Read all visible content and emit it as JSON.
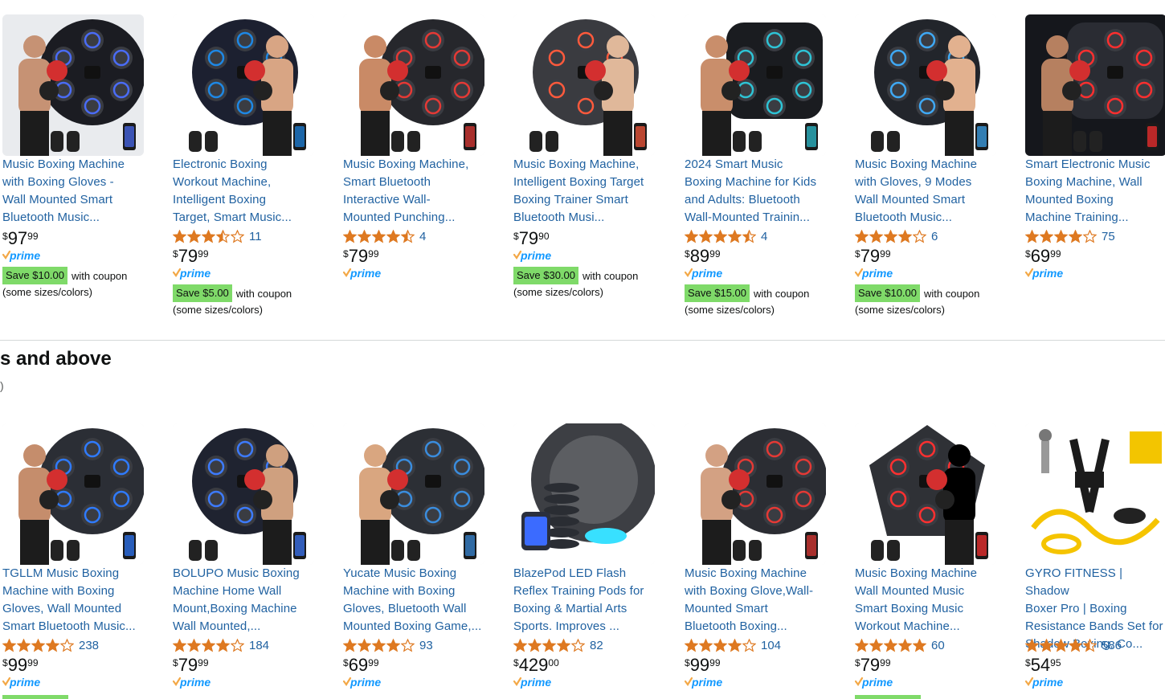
{
  "section": {
    "title": "s and above",
    "subtitle": ")"
  },
  "colors": {
    "link": "#2162a1",
    "star": "#de7921",
    "coupon": "#7fda69",
    "prime": "#1399ff"
  },
  "row1": [
    {
      "title_lines": [
        "Music Boxing Machine",
        "with Boxing Gloves -",
        "Wall Mounted Smart",
        "Bluetooth Music..."
      ],
      "rating": null,
      "review_count": null,
      "price": {
        "currency": "$",
        "whole": "97",
        "fraction": "99"
      },
      "prime_label": "prime",
      "coupon": {
        "badge": "Save $10.00",
        "suffix": "with coupon"
      },
      "note": "(some sizes/colors)",
      "image": {
        "bg": "#e9ebee",
        "device": "#1b1c22",
        "accent": "#4a6cf7",
        "person": "#c69274",
        "icon": "hexagon-device-with-boxer"
      }
    },
    {
      "title_lines": [
        "Electronic Boxing",
        "Workout Machine,",
        "Intelligent Boxing",
        "Target, Smart Music..."
      ],
      "rating": 3.5,
      "review_count": "11",
      "price": {
        "currency": "$",
        "whole": "79",
        "fraction": "99"
      },
      "prime_label": "prime",
      "coupon": {
        "badge": "Save $5.00",
        "suffix": "with coupon"
      },
      "note": "(some sizes/colors)",
      "image": {
        "bg": "#ffffff",
        "device": "#1c2030",
        "accent": "#1e88e5",
        "person": "#d8a584",
        "icon": "round-device-blue-arrows"
      }
    },
    {
      "title_lines": [
        "Music Boxing Machine,",
        "Smart Bluetooth",
        "Interactive Wall-",
        "Mounted Punching..."
      ],
      "rating": 4.5,
      "review_count": "4",
      "price": {
        "currency": "$",
        "whole": "79",
        "fraction": "99"
      },
      "prime_label": "prime",
      "coupon": null,
      "note": "",
      "image": {
        "bg": "#ffffff",
        "device": "#26272c",
        "accent": "#e53935",
        "person": "#c98a66",
        "icon": "round-device-red-lights"
      }
    },
    {
      "title_lines": [
        "Music Boxing Machine,",
        "Intelligent Boxing Target",
        "Boxing Trainer Smart",
        "Bluetooth Musi..."
      ],
      "rating": null,
      "review_count": null,
      "price": {
        "currency": "$",
        "whole": "79",
        "fraction": "90"
      },
      "prime_label": "prime",
      "coupon": {
        "badge": "Save $30.00",
        "suffix": "with coupon"
      },
      "note": "(some sizes/colors)",
      "image": {
        "bg": "#ffffff",
        "device": "#3a3b40",
        "accent": "#ff5a3c",
        "person": "#e0b89a",
        "icon": "round-device-woman-boxer"
      }
    },
    {
      "title_lines": [
        "2024 Smart Music",
        "Boxing Machine for Kids",
        "and Adults: Bluetooth",
        "Wall-Mounted Trainin..."
      ],
      "rating": 4.5,
      "review_count": "4",
      "price": {
        "currency": "$",
        "whole": "89",
        "fraction": "99"
      },
      "prime_label": "prime",
      "coupon": {
        "badge": "Save $15.00",
        "suffix": "with coupon"
      },
      "note": "(some sizes/colors)",
      "image": {
        "bg": "#ffffff",
        "device": "#1a1c20",
        "accent": "#2ec4d6",
        "person": "#c98e6b",
        "icon": "square-device-cyan-lights"
      }
    },
    {
      "title_lines": [
        "Music Boxing Machine",
        "with Gloves, 9 Modes",
        "Wall Mounted Smart",
        "Bluetooth Music..."
      ],
      "rating": 4.0,
      "review_count": "6",
      "price": {
        "currency": "$",
        "whole": "79",
        "fraction": "99"
      },
      "prime_label": "prime",
      "coupon": {
        "badge": "Save $10.00",
        "suffix": "with coupon"
      },
      "note": "(some sizes/colors)",
      "image": {
        "bg": "#ffffff",
        "device": "#22252b",
        "accent": "#3fa9f5",
        "person": "#e2b18f",
        "icon": "hexagon-device-gloves"
      }
    },
    {
      "title_lines": [
        "Smart Electronic Music",
        "Boxing Machine, Wall",
        "Mounted Boxing",
        "Machine Training..."
      ],
      "rating": 4.0,
      "review_count": "75",
      "price": {
        "currency": "$",
        "whole": "69",
        "fraction": "99"
      },
      "prime_label": "prime",
      "coupon": null,
      "note": "",
      "image": {
        "bg": "#15171c",
        "device": "#2a2c33",
        "accent": "#ff2f2f",
        "person": "#b68060",
        "icon": "dark-device-red-target"
      }
    }
  ],
  "row2": [
    {
      "title_lines": [
        "TGLLM Music Boxing",
        "Machine with Boxing",
        "Gloves, Wall Mounted",
        "Smart Bluetooth Music..."
      ],
      "rating": 4.0,
      "review_count": "238",
      "price": {
        "currency": "$",
        "whole": "99",
        "fraction": "99"
      },
      "prime_label": "prime",
      "image": {
        "bg": "#ffffff",
        "device": "#2b2e35",
        "accent": "#2f7bff",
        "person": "#c58d6c",
        "icon": "round-device-bald-boxer"
      }
    },
    {
      "title_lines": [
        "BOLUPO Music Boxing",
        "Machine Home Wall",
        "Mount,Boxing Machine",
        "Wall Mounted,..."
      ],
      "rating": 4.0,
      "review_count": "184",
      "price": {
        "currency": "$",
        "whole": "79",
        "fraction": "99"
      },
      "prime_label": "prime",
      "image": {
        "bg": "#ffffff",
        "device": "#1f2330",
        "accent": "#3d7bff",
        "person": "#cfa07f",
        "icon": "round-device-blue-hexagons"
      }
    },
    {
      "title_lines": [
        "Yucate Music Boxing",
        "Machine with Boxing",
        "Gloves, Bluetooth Wall",
        "Mounted Boxing Game,..."
      ],
      "rating": 4.0,
      "review_count": "93",
      "price": {
        "currency": "$",
        "whole": "69",
        "fraction": "99"
      },
      "prime_label": "prime",
      "image": {
        "bg": "#ffffff",
        "device": "#2c2f35",
        "accent": "#3a8dde",
        "person": "#d9a680",
        "icon": "round-device-red-gloves"
      }
    },
    {
      "title_lines": [
        "BlazePod LED Flash",
        "Reflex Training Pods for",
        "Boxing & Martial Arts",
        "Sports. Improves ..."
      ],
      "rating": 4.0,
      "review_count": "82",
      "price": {
        "currency": "$",
        "whole": "429",
        "fraction": "00"
      },
      "prime_label": "prime",
      "image": {
        "bg": "#ffffff",
        "device": "#2a2d33",
        "accent": "#38e0ff",
        "person": "#8b7a6a",
        "icon": "led-pods"
      }
    },
    {
      "title_lines": [
        "Music Boxing Machine",
        "with Boxing Glove,Wall-",
        "Mounted Smart",
        "Bluetooth Boxing..."
      ],
      "rating": 4.0,
      "review_count": "104",
      "price": {
        "currency": "$",
        "whole": "99",
        "fraction": "99"
      },
      "prime_label": "prime",
      "image": {
        "bg": "#ffffff",
        "device": "#2b2d33",
        "accent": "#e53935",
        "person": "#d3a183",
        "icon": "round-device-red-lights-boxer"
      }
    },
    {
      "title_lines": [
        "Music Boxing Machine",
        "Wall Mounted Music",
        "Smart Boxing Music",
        "Workout Machine..."
      ],
      "rating": 5.0,
      "review_count": "60",
      "price": {
        "currency": "$",
        "whole": "79",
        "fraction": "99"
      },
      "prime_label": "prime",
      "image": {
        "bg": "#ffffff",
        "device": "#2f3136",
        "accent": "#ff3030",
        "person": "#000000",
        "icon": "pentagon-device-red-chevrons"
      }
    },
    {
      "title_lines": [
        "GYRO FITNESS | Shadow",
        "Boxer Pro | Boxing",
        "Resistance Bands Set for",
        "Shadow Boxing, Co..."
      ],
      "rating": 4.5,
      "review_count": "586",
      "price": {
        "currency": "$",
        "whole": "54",
        "fraction": "95"
      },
      "prime_label": "prime",
      "image": {
        "bg": "#ffffff",
        "device": "#1b1b1b",
        "accent": "#f5c400",
        "person": "#9a9a9a",
        "icon": "resistance-bands"
      }
    }
  ]
}
